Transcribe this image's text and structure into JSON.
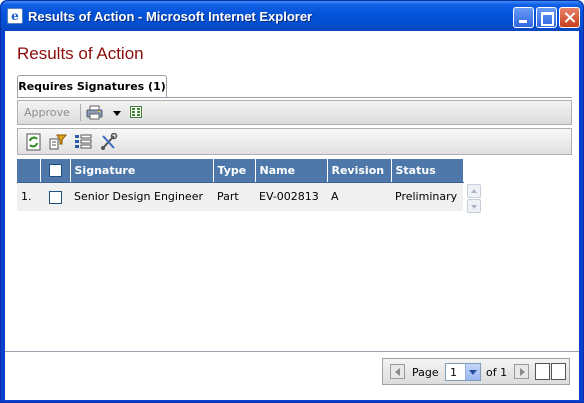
{
  "window": {
    "title": "Results of Action - Microsoft Internet Explorer"
  },
  "page": {
    "title": "Results of Action",
    "tab_label": "Requires Signatures (1)"
  },
  "toolbar": {
    "approve_label": "Approve",
    "icons": [
      "printer-icon",
      "dropdown-caret-icon",
      "export-icon"
    ],
    "tools": [
      "refresh-icon",
      "filter-icon",
      "column-chooser-icon",
      "settings-icon"
    ]
  },
  "table": {
    "columns": [
      "Signature",
      "Type",
      "Name",
      "Revision",
      "Status"
    ],
    "rows": [
      {
        "index": "1.",
        "signature": "Senior Design Engineer",
        "type": "Part",
        "name": "EV-002813",
        "revision": "A",
        "status": "Preliminary"
      }
    ]
  },
  "pager": {
    "page_label": "Page",
    "current_page": "1",
    "of_label": "of 1"
  },
  "colors": {
    "title_red": "#8b0c0c",
    "header_blue": "#4e78a9",
    "titlebar_blue": "#0453d8"
  }
}
